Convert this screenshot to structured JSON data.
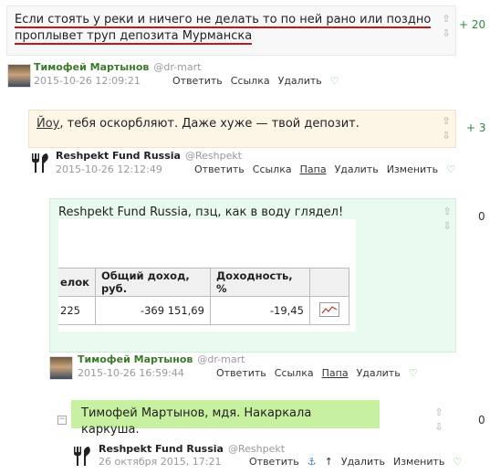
{
  "colors": {
    "accent_green": "#2f8a3a",
    "underline_red": "#c21818",
    "box_neutral": "#f8f8f8",
    "box_beige": "#fdf5e6",
    "box_mint": "#e9fbee",
    "box_lime": "#c7f1a0"
  },
  "comments": [
    {
      "text_line1": "Если стоять у реки и ничего не делать то по ней рано или поздно",
      "text_line2": "проплывет труп депозита Мурманска",
      "score": "+ 20",
      "author": "Тимофей Мартынов",
      "handle": "@dr-mart",
      "date": "2015-10-26 12:09:21",
      "actions": [
        "Ответить",
        "Ссылка",
        "Удалить"
      ]
    },
    {
      "mention": "Йоу",
      "text": ", тебя оскорбляют. Даже хуже — твой депозит.",
      "score": "+ 3",
      "author": "Reshpekt Fund Russia",
      "handle": "@Reshpekt",
      "date": "2015-10-26 12:12:49",
      "actions": [
        "Ответить",
        "Ссылка",
        "Папа",
        "Удалить",
        "Изменить"
      ]
    },
    {
      "text": "Reshpekt Fund Russia, пзц, как в воду глядел!",
      "score": "0",
      "table": {
        "headers": [
          "елок",
          "Общий доход, руб.",
          "Доходность, %",
          ""
        ],
        "row": [
          "225",
          "-369 151,69",
          "-19,45",
          ""
        ]
      },
      "author": "Тимофей Мартынов",
      "handle": "@dr-mart",
      "date": "2015-10-26 16:59:44",
      "actions": [
        "Ответить",
        "Ссылка",
        "Папа",
        "Удалить"
      ]
    },
    {
      "text": "Тимофей Мартынов, мдя. Накаркала каркуша.",
      "score": "0",
      "author": "Reshpekt Fund Russia",
      "handle": "@Reshpekt",
      "date": "26 октября 2015, 17:21",
      "actions": [
        "Ответить",
        "Удалить",
        "Изменить"
      ]
    }
  ]
}
